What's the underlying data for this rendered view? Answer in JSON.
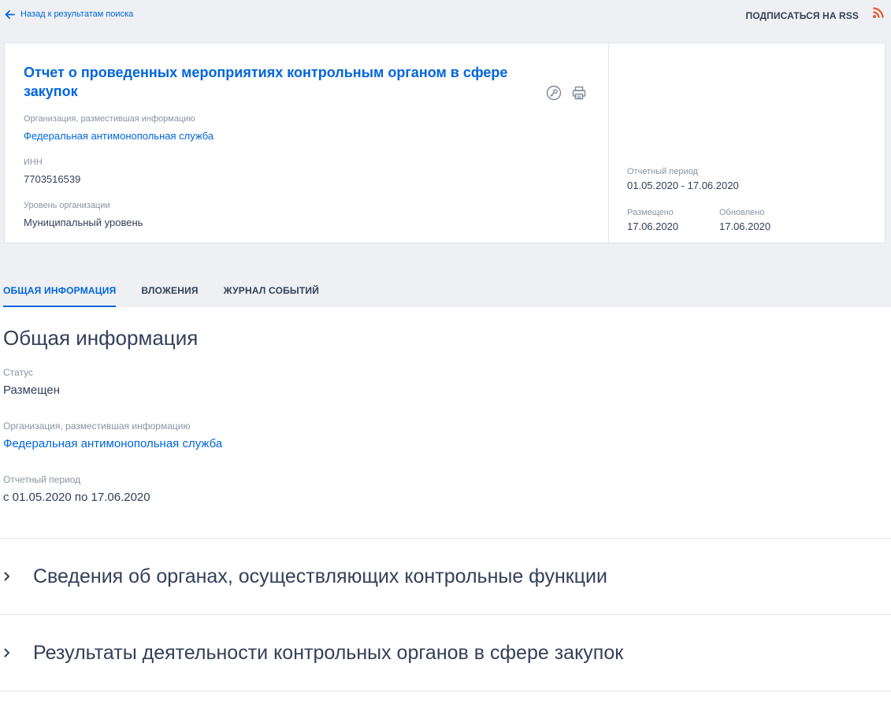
{
  "nav": {
    "back_label": "Назад к результатам поиска",
    "rss_label": "ПОДПИСАТЬСЯ НА RSS"
  },
  "card": {
    "title": "Отчет о проведенных мероприятиях контрольным органом в сфере закупок",
    "org_label": "Организация, разместившая информацию",
    "org_value": "Федеральная антимонопольная служба",
    "inn_label": "ИНН",
    "inn_value": "7703516539",
    "level_label": "Уровень организации",
    "level_value": "Муниципальный уровень",
    "period_label": "Отчетный период",
    "period_value": "01.05.2020 - 17.06.2020",
    "placed_label": "Размещено",
    "placed_value": "17.06.2020",
    "updated_label": "Обновлено",
    "updated_value": "17.06.2020"
  },
  "tabs": [
    {
      "label": "ОБЩАЯ ИНФОРМАЦИЯ",
      "active": true
    },
    {
      "label": "ВЛОЖЕНИЯ",
      "active": false
    },
    {
      "label": "ЖУРНАЛ СОБЫТИЙ",
      "active": false
    }
  ],
  "general": {
    "title": "Общая информация",
    "status_label": "Статус",
    "status_value": "Размещен",
    "org_label": "Организация, разместившая информацию",
    "org_value": "Федеральная антимонопольная служба",
    "period_label": "Отчетный период",
    "period_value": "с 01.05.2020 по 17.06.2020"
  },
  "accordions": [
    {
      "title": "Сведения об органах, осуществляющих контрольные функции"
    },
    {
      "title": "Результаты деятельности контрольных органов в сфере закупок"
    }
  ],
  "colors": {
    "accent": "#0065dd",
    "text": "#334059",
    "muted": "#8a93a3",
    "rss": "#e8572b",
    "background_top": "#eef0f3"
  },
  "icons": {
    "back": "arrow-left-icon",
    "rss": "rss-icon",
    "key": "key-icon",
    "print": "printer-icon",
    "chevron": "chevron-right-icon"
  }
}
